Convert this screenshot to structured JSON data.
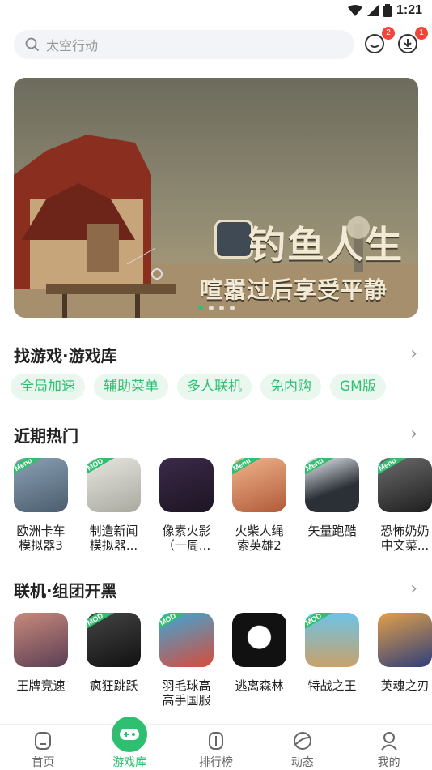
{
  "status": {
    "time": "1:21"
  },
  "search": {
    "placeholder": "太空行动"
  },
  "top_badges": {
    "messages": "2",
    "downloads": "1"
  },
  "banner": {
    "title": "钓鱼人生",
    "subtitle": "喧嚣过后享受平静",
    "dots": 4,
    "active_dot": 0
  },
  "sections": {
    "library": {
      "title": "找游戏·游戏库",
      "chips": [
        "全局加速",
        "辅助菜单",
        "多人联机",
        "免内购",
        "GM版"
      ]
    },
    "hot": {
      "title": "近期热门",
      "apps": [
        {
          "name": "欧洲卡车模拟器3",
          "tag": "Menu"
        },
        {
          "name": "制造新闻模拟器...",
          "tag": "MOD"
        },
        {
          "name": "像素火影（一周...",
          "tag": ""
        },
        {
          "name": "火柴人绳索英雄2",
          "tag": "Menu"
        },
        {
          "name": "矢量跑酷",
          "tag": "Menu"
        },
        {
          "name": "恐怖奶奶中文菜...",
          "tag": "Menu"
        }
      ]
    },
    "online": {
      "title": "联机·组团开黑",
      "apps": [
        {
          "name": "王牌竞速",
          "tag": ""
        },
        {
          "name": "疯狂跳跃",
          "tag": "MOD"
        },
        {
          "name": "羽毛球高高手国服",
          "tag": "MOD"
        },
        {
          "name": "逃离森林",
          "tag": ""
        },
        {
          "name": "特战之王",
          "tag": "MOD"
        },
        {
          "name": "英魂之刃",
          "tag": ""
        }
      ]
    }
  },
  "tabs": [
    {
      "label": "首页",
      "icon": "home-icon"
    },
    {
      "label": "游戏库",
      "icon": "gamepad-icon",
      "active": true
    },
    {
      "label": "排行榜",
      "icon": "ranking-icon"
    },
    {
      "label": "动态",
      "icon": "feed-icon"
    },
    {
      "label": "我的",
      "icon": "profile-icon"
    }
  ],
  "colors": {
    "accent": "#2fbf71",
    "badge": "#f4433b",
    "chip_bg": "#e9f7ef"
  }
}
